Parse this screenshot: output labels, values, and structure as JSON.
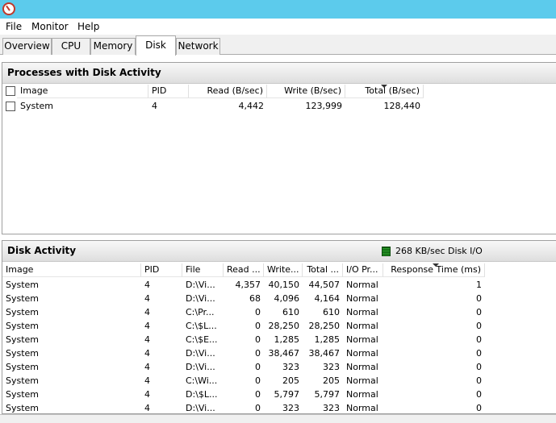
{
  "menu": {
    "file": "File",
    "monitor": "Monitor",
    "help": "Help"
  },
  "tabs": {
    "overview": "Overview",
    "cpu": "CPU",
    "memory": "Memory",
    "disk": "Disk",
    "network": "Network"
  },
  "processes": {
    "title": "Processes with Disk Activity",
    "columns": {
      "image": "Image",
      "pid": "PID",
      "read": "Read (B/sec)",
      "write": "Write (B/sec)",
      "total": "Total (B/sec)"
    },
    "rows": [
      {
        "image": "System",
        "pid": "4",
        "read": "4,442",
        "write": "123,999",
        "total": "128,440"
      }
    ]
  },
  "disk_activity": {
    "title": "Disk Activity",
    "io_label": "268 KB/sec Disk I/O",
    "columns": {
      "image": "Image",
      "pid": "PID",
      "file": "File",
      "read": "Read ...",
      "write": "Write...",
      "total": "Total ...",
      "io_priority": "I/O Pr...",
      "response_time": "Response Time (ms)"
    },
    "rows": [
      {
        "image": "System",
        "pid": "4",
        "file": "D:\\Vi...",
        "read": "4,357",
        "write": "40,150",
        "total": "44,507",
        "priority": "Normal",
        "response": "1"
      },
      {
        "image": "System",
        "pid": "4",
        "file": "D:\\Vi...",
        "read": "68",
        "write": "4,096",
        "total": "4,164",
        "priority": "Normal",
        "response": "0"
      },
      {
        "image": "System",
        "pid": "4",
        "file": "C:\\Pr...",
        "read": "0",
        "write": "610",
        "total": "610",
        "priority": "Normal",
        "response": "0"
      },
      {
        "image": "System",
        "pid": "4",
        "file": "C:\\$L...",
        "read": "0",
        "write": "28,250",
        "total": "28,250",
        "priority": "Normal",
        "response": "0"
      },
      {
        "image": "System",
        "pid": "4",
        "file": "C:\\$E...",
        "read": "0",
        "write": "1,285",
        "total": "1,285",
        "priority": "Normal",
        "response": "0"
      },
      {
        "image": "System",
        "pid": "4",
        "file": "D:\\Vi...",
        "read": "0",
        "write": "38,467",
        "total": "38,467",
        "priority": "Normal",
        "response": "0"
      },
      {
        "image": "System",
        "pid": "4",
        "file": "D:\\Vi...",
        "read": "0",
        "write": "323",
        "total": "323",
        "priority": "Normal",
        "response": "0"
      },
      {
        "image": "System",
        "pid": "4",
        "file": "C:\\Wi...",
        "read": "0",
        "write": "205",
        "total": "205",
        "priority": "Normal",
        "response": "0"
      },
      {
        "image": "System",
        "pid": "4",
        "file": "D:\\$L...",
        "read": "0",
        "write": "5,797",
        "total": "5,797",
        "priority": "Normal",
        "response": "0"
      },
      {
        "image": "System",
        "pid": "4",
        "file": "D:\\Vi...",
        "read": "0",
        "write": "323",
        "total": "323",
        "priority": "Normal",
        "response": "0"
      }
    ]
  }
}
